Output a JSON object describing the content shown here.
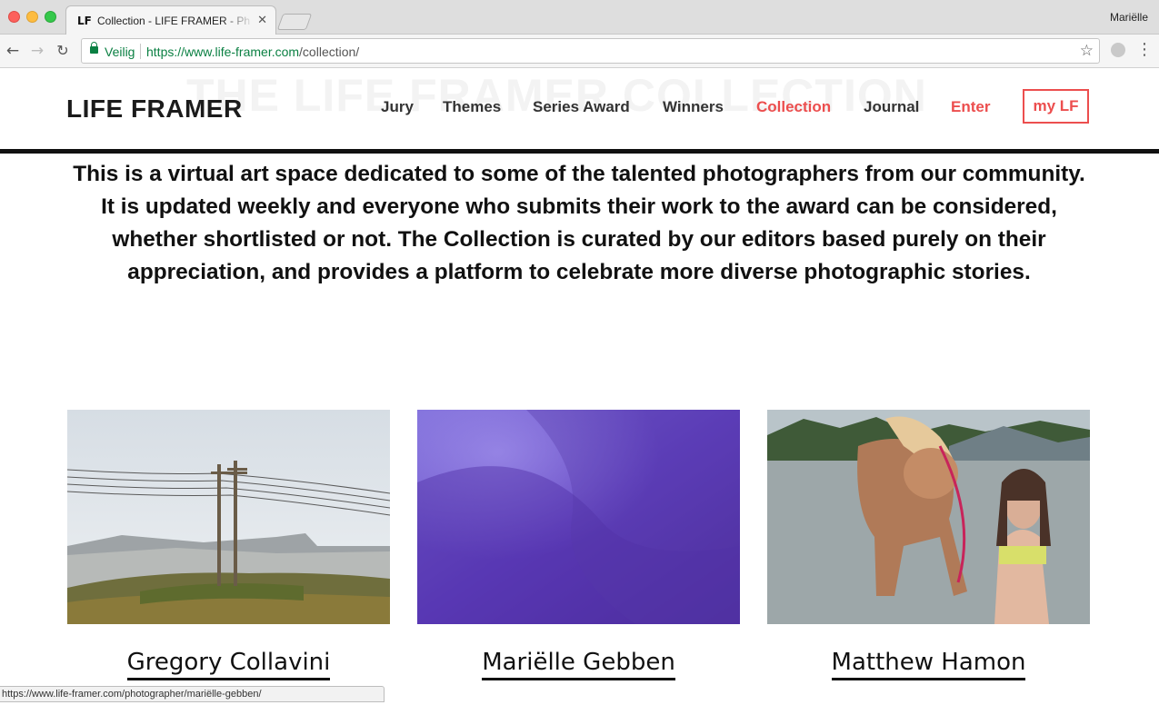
{
  "browser": {
    "tab": {
      "title": "Collection - LIFE FRAMER - Ph",
      "favicon": "LF"
    },
    "profile_name": "Mariëlle",
    "secure_label": "Veilig",
    "url_host": "https://www.life-framer.com",
    "url_path": "/collection/"
  },
  "site": {
    "logo": "LIFE FRAMER",
    "ghost_title": "THE LIFE FRAMER COLLECTION",
    "nav": {
      "jury": "Jury",
      "themes": "Themes",
      "series_award": "Series Award",
      "winners": "Winners",
      "collection": "Collection",
      "journal": "Journal",
      "enter": "Enter",
      "my_lf": "my LF"
    },
    "accent_color": "#ec4e4e",
    "intro": "This is a virtual art space dedicated to some of the talented photographers from our community. It is updated weekly and everyone who submits their work to the award can be considered, whether shortlisted or not. The Collection is curated by our editors based purely on their appreciation, and provides a platform to celebrate more diverse photographic stories."
  },
  "collection": [
    {
      "photographer": "Gregory Collavini",
      "image": "landscape-power-lines"
    },
    {
      "photographer": "Mariëlle Gebben",
      "image": "purple-fabric-abstract"
    },
    {
      "photographer": "Matthew Hamon",
      "image": "woman-with-horse-in-lake"
    }
  ],
  "status_url": "https://www.life-framer.com/photographer/mariëlle-gebben/"
}
